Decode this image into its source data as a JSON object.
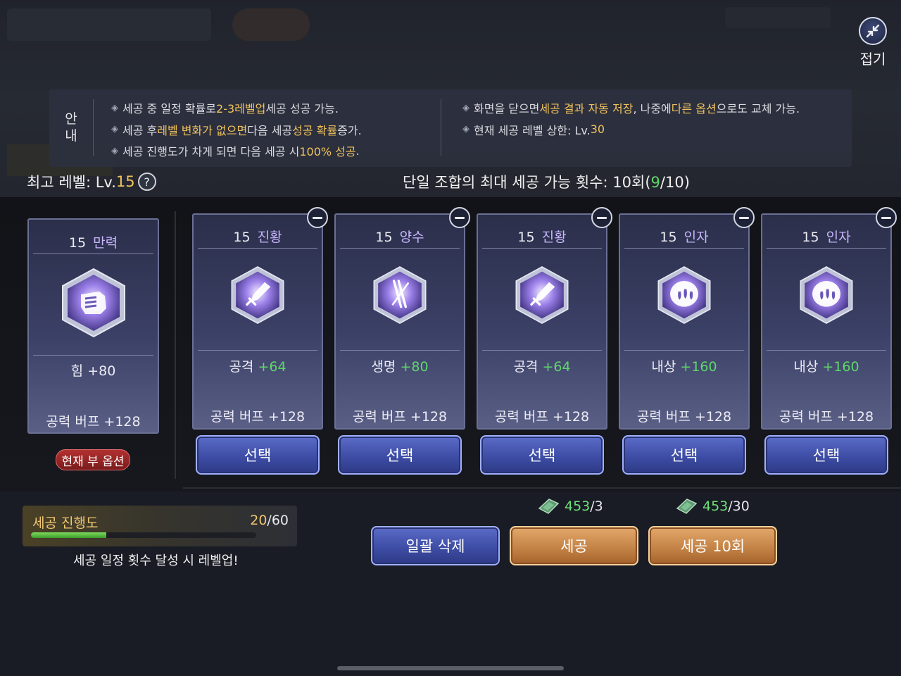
{
  "header": {
    "fold_label": "접기"
  },
  "notice": {
    "title": "안내",
    "left": [
      {
        "a": "세공 중 일정 확률로 ",
        "b": "2-3레벨업",
        "c": " 세공 성공 가능."
      },
      {
        "a": "세공 후 ",
        "b": "레벨 변화가 없으면",
        "c": " 다음 세공 ",
        "d": "성공 확률",
        "e": " 증가."
      },
      {
        "a": "세공 진행도가 차게 되면 다음 세공 시 ",
        "b": "100% 성공",
        "c": "."
      }
    ],
    "right": [
      {
        "a": "화면을 닫으면 ",
        "b": "세공 결과 자동 저장",
        "c": ", 나중에 ",
        "d": "다른 옵션",
        "e": "으로도 교체 가능."
      },
      {
        "a": "현재 세공 레벨 상한: Lv.",
        "b": "30",
        "c": ""
      }
    ]
  },
  "status": {
    "best_level_label": "최고 레벨: Lv.",
    "best_level_value": "15",
    "help": "?",
    "max_count_label": "단일 조합의 최대 세공 가능 횟수: 10회(",
    "max_count_current": "9",
    "max_count_rest": "/10)"
  },
  "current": {
    "level": "15",
    "name": "만력",
    "stat_label": "힘",
    "stat_value": "+80",
    "buff": "공력 버프 +128",
    "tag": "현재 부 옵션",
    "icon": "fist-gem-icon"
  },
  "options": [
    {
      "level": "15",
      "name": "진황",
      "stat_label": "공격",
      "stat_value": "+64",
      "buff": "공력 버프 +128",
      "select": "선택",
      "icon": "sword-gem-icon"
    },
    {
      "level": "15",
      "name": "양수",
      "stat_label": "생명",
      "stat_value": "+80",
      "buff": "공력 버프 +128",
      "select": "선택",
      "icon": "blades-gem-icon"
    },
    {
      "level": "15",
      "name": "진황",
      "stat_label": "공격",
      "stat_value": "+64",
      "buff": "공력 버프 +128",
      "select": "선택",
      "icon": "sword-gem-icon"
    },
    {
      "level": "15",
      "name": "인자",
      "stat_label": "내상",
      "stat_value": "+160",
      "buff": "공력 버프 +128",
      "select": "선택",
      "icon": "drops-gem-icon"
    },
    {
      "level": "15",
      "name": "인자",
      "stat_label": "내상",
      "stat_value": "+160",
      "buff": "공력 버프 +128",
      "select": "선택",
      "icon": "drops-gem-icon"
    }
  ],
  "progress": {
    "label": "세공 진행도",
    "current": "20",
    "total": "/60",
    "fraction": 0.333,
    "hint": "세공 일정 횟수 달성 시 레벨업!"
  },
  "actions": {
    "delete_all": "일괄 삭제",
    "refine": "세공",
    "refine10": "세공 10회",
    "refine_cost_have": "453",
    "refine_cost_need": "/3",
    "refine10_cost_have": "453",
    "refine10_cost_need": "/30"
  }
}
